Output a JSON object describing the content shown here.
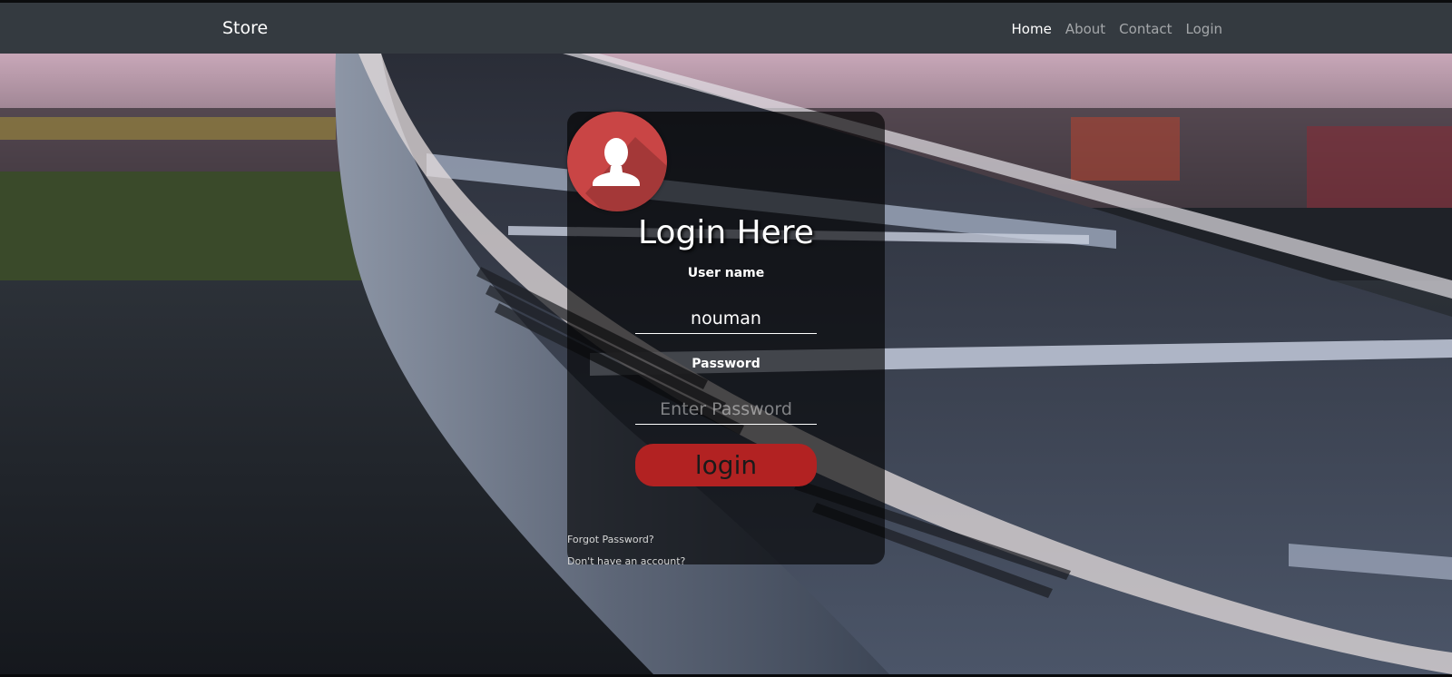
{
  "navbar": {
    "brand": "Store",
    "links": [
      {
        "label": "Home",
        "active": true
      },
      {
        "label": "About"
      },
      {
        "label": "Contact"
      },
      {
        "label": "Login"
      }
    ]
  },
  "login_card": {
    "avatar_icon": "user-silhouette-icon",
    "title": "Login Here",
    "username": {
      "label": "User name",
      "value": "nouman"
    },
    "password": {
      "label": "Password",
      "placeholder": "Enter Password",
      "value": ""
    },
    "submit_label": "login",
    "forgot_password_link": "Forgot Password?",
    "signup_link": "Don't have an account?"
  },
  "colors": {
    "navbar_bg": "#343a40",
    "avatar_bg": "#c94545",
    "button_bg": "#b22222"
  }
}
